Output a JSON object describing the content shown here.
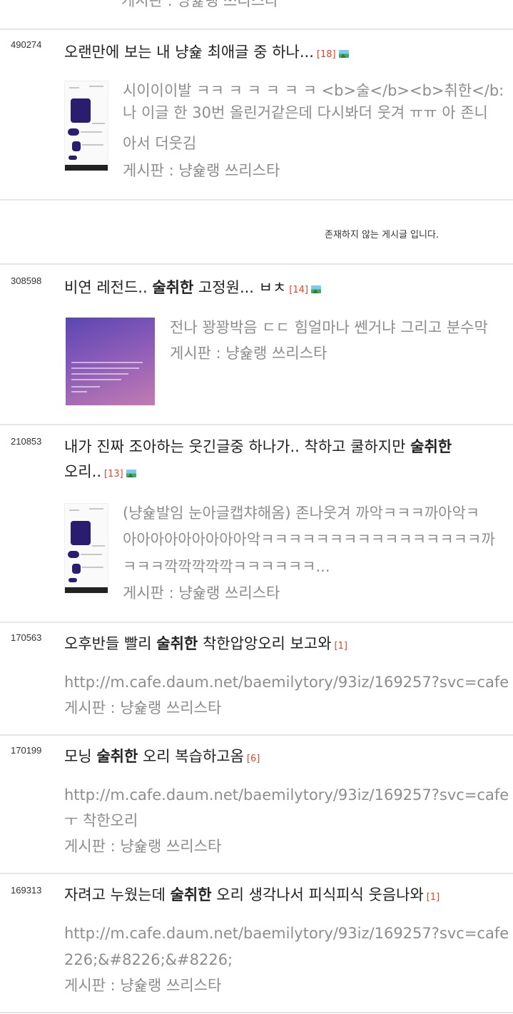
{
  "top_partial": {
    "board_label": "게시판 : 냥슕랭 쓰리스타"
  },
  "posts": [
    {
      "number": "490274",
      "title_pre": "오랜만에 보는 내 냥슕 최애글 중 하나...",
      "title_bold": "",
      "title_post": "",
      "comments": "[18]",
      "has_image_icon": true,
      "desc_lines": [
        "시이이이발 ㅋㅋ ㅋ ㅋ ㅋ ㅋ ㅋ <b>술</b><b>취한</b:",
        "나 이글 한 30번 올린거같은데 다시봐더 웃겨 ㅠㅠ 아 존니",
        "아서 더웃김"
      ],
      "board_label": "게시판 : 냥슕랭 쓰리스타"
    },
    {
      "number": "308598",
      "title_pre": "비연 레전드..",
      "title_bold": "술취한",
      "title_post": "고정원... ㅂㅊ",
      "comments": "[14]",
      "has_image_icon": true,
      "desc_lines": [
        "전나 꽝꽝박음 ㄷㄷ 힘얼마나 쎈거냐 그리고 분수막"
      ],
      "board_label": "게시판 : 냥슕랭 쓰리스타"
    },
    {
      "number": "210853",
      "title_pre": "내가 진짜 조아하는 웃긴글중 하나가.. 착하고 쿨하지만",
      "title_bold": "술취한",
      "title_line2": "오리..",
      "comments": "[13]",
      "has_image_icon": true,
      "desc_lines": [
        "(냥슕발임 눈아글캡챠해옴) 존나웃겨 까악ㅋㅋㅋ까아악ㅋ",
        "아아아아아아아아아악ㅋㅋㅋㅋㅋㅋㅋㅋㅋㅋㅋㅋㅋㅋㅋㅋ까",
        "ㅋㅋㅋ깍깍깍깍깍ㅋㅋㅋㅋㅋㅋ..."
      ],
      "board_label": "게시판 : 냥슕랭 쓰리스타"
    },
    {
      "number": "170563",
      "title_pre": "오후반들 빨리",
      "title_bold": "술취한",
      "title_post": "착한압앙오리 보고와",
      "comments": "[1]",
      "has_image_icon": false,
      "desc_lines": [
        "http://m.cafe.daum.net/baemilytory/93iz/169257?svc=cafe"
      ],
      "board_label": "게시판 : 냥슕랭 쓰리스타"
    },
    {
      "number": "170199",
      "title_pre": "모닝",
      "title_bold": "술취한",
      "title_post": "오리 복습하고옴",
      "comments": "[6]",
      "has_image_icon": false,
      "desc_lines": [
        "http://m.cafe.daum.net/baemilytory/93iz/169257?svc=cafe",
        "ㅜ 착한오리"
      ],
      "board_label": "게시판 : 냥슕랭 쓰리스타"
    },
    {
      "number": "169313",
      "title_pre": "자려고 누웠는데",
      "title_bold": "술취한",
      "title_post": "오리 생각나서 피식피식 웃음나와",
      "comments": "[1]",
      "has_image_icon": false,
      "desc_lines": [
        "http://m.cafe.daum.net/baemilytory/93iz/169257?svc=cafe",
        "226;&#8226;&#8226;"
      ],
      "board_label": "게시판 : 냥슕랭 쓰리스타"
    }
  ],
  "deleted_notice": "존재하지 않는 게시글 입니다."
}
